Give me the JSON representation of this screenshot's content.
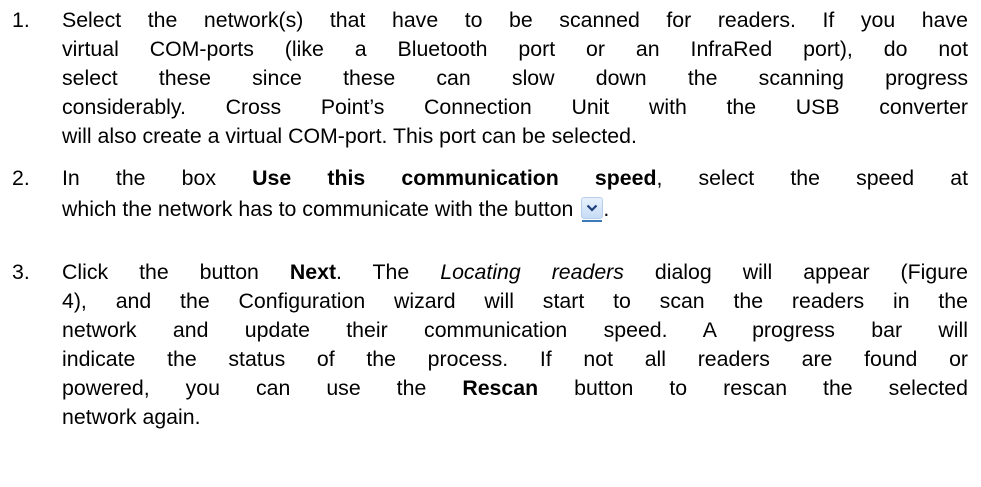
{
  "items": [
    {
      "number": "1.",
      "lines": [
        "Select the network(s) that have to be scanned for readers. If you have",
        "virtual COM-ports (like a Bluetooth port or an InfraRed port), do not",
        "select these since these can slow down the scanning progress",
        "considerably. Cross Point’s Connection Unit with the USB converter",
        "will also create a virtual COM-port. This port can be selected."
      ]
    },
    {
      "number": "2.",
      "l1_a": "In the box ",
      "l1_b": "Use this communication speed",
      "l1_c": ", select the speed at",
      "l2_a": "which the network has to communicate with the button ",
      "l2_b": "."
    },
    {
      "number": "3.",
      "l1_a": "Click the button ",
      "l1_b": "Next",
      "l1_c": ". The ",
      "l1_d": "Locating readers",
      "l1_e": " dialog will appear (Figure",
      "lines_mid": [
        "4), and the Configuration wizard will start to scan the readers in the",
        "network and update their communication speed. A progress bar will",
        "indicate the status of the process. If not all readers are found or"
      ],
      "l5_a": "powered, you can use the ",
      "l5_b": "Rescan",
      "l5_c": " button to rescan the selected",
      "l6": "network again."
    }
  ],
  "icons": {
    "dropdown_button": "chevron-down-icon"
  }
}
